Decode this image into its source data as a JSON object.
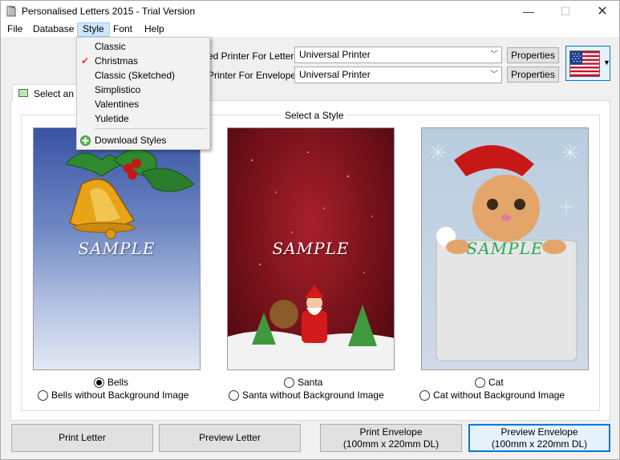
{
  "window": {
    "title": "Personalised Letters 2015 - Trial Version"
  },
  "menubar": {
    "items": [
      "File",
      "Database",
      "Style",
      "Font",
      "Help"
    ]
  },
  "style_menu": {
    "items": [
      "Classic",
      "Christmas",
      "Classic (Sketched)",
      "Simplistico",
      "Valentines",
      "Yuletide"
    ],
    "checked": "Christmas",
    "download": "Download Styles"
  },
  "printers": {
    "letters_label": "ed Printer For Letters",
    "letters_value": "Universal Printer",
    "envelopes_label": "Printer For Envelopes",
    "envelopes_value": "Universal Printer",
    "properties_label": "Properties"
  },
  "tab": {
    "label": "Select an E"
  },
  "group": {
    "title": "Select a Style"
  },
  "styles": [
    {
      "name": "Bells",
      "alt": "Bells without Background Image",
      "sample": "SAMPLE",
      "selected": true
    },
    {
      "name": "Santa",
      "alt": "Santa without Background Image",
      "sample": "SAMPLE",
      "selected": false
    },
    {
      "name": "Cat",
      "alt": "Cat without Background Image",
      "sample": "SAMPLE",
      "selected": false
    }
  ],
  "buttons": {
    "print_letter": "Print Letter",
    "preview_letter": "Preview Letter",
    "print_envelope": "Print Envelope",
    "preview_envelope": "Preview Envelope",
    "envelope_size": "(100mm x 220mm DL)"
  },
  "colors": {
    "accent": "#0078d7",
    "menu_highlight": "#cce8ff",
    "check": "#e04030"
  }
}
